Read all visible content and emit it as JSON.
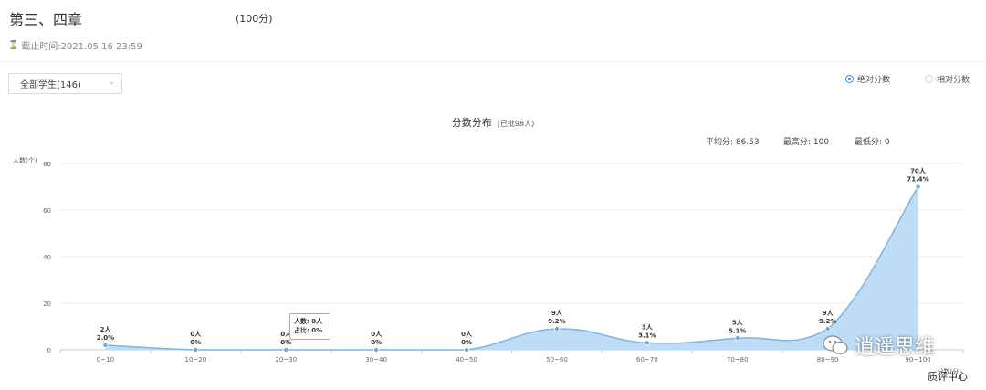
{
  "header": {
    "title": "第三、四章",
    "total_score": "(100分)",
    "deadline": "截止时间:2021.05.16 23:59"
  },
  "filter": {
    "selected": "全部学生(146)"
  },
  "score_mode": {
    "absolute_label": "绝对分数",
    "relative_label": "相对分数",
    "selected": "absolute"
  },
  "chart_header": {
    "title": "分数分布",
    "subtitle": "(已批98人)",
    "avg_label": "平均分: 86.53",
    "max_label": "最高分: 100",
    "min_label": "最低分: 0"
  },
  "tooltip": {
    "line1": "人数: 0人",
    "line2": "占比: 0%"
  },
  "watermark": {
    "text": "逍遥思维",
    "sub": "质评中心"
  },
  "colors": {
    "line": "#7fb3e2",
    "fill": "#bcdaf5",
    "point": "#6fa8dc",
    "grid": "#ebebeb",
    "accent": "#2d8cf0"
  },
  "chart_data": {
    "type": "area",
    "title": "分数分布",
    "xlabel": "分数(分)",
    "ylabel": "人数(个)",
    "ylim": [
      0,
      80
    ],
    "yticks": [
      0,
      20,
      40,
      60,
      80
    ],
    "grid": true,
    "categories": [
      "0~10",
      "10~20",
      "20~30",
      "30~40",
      "40~50",
      "50~60",
      "60~70",
      "70~80",
      "80~90",
      "90~100"
    ],
    "counts": [
      2,
      0,
      0,
      0,
      0,
      9,
      3,
      5,
      9,
      70
    ],
    "count_labels": [
      "2人",
      "0人",
      "0人",
      "0人",
      "0人",
      "9人",
      "3人",
      "5人",
      "9人",
      "70人"
    ],
    "percent_labels": [
      "2.0%",
      "0%",
      "0%",
      "0%",
      "0%",
      "9.2%",
      "3.1%",
      "5.1%",
      "9.2%",
      "71.4%"
    ]
  }
}
